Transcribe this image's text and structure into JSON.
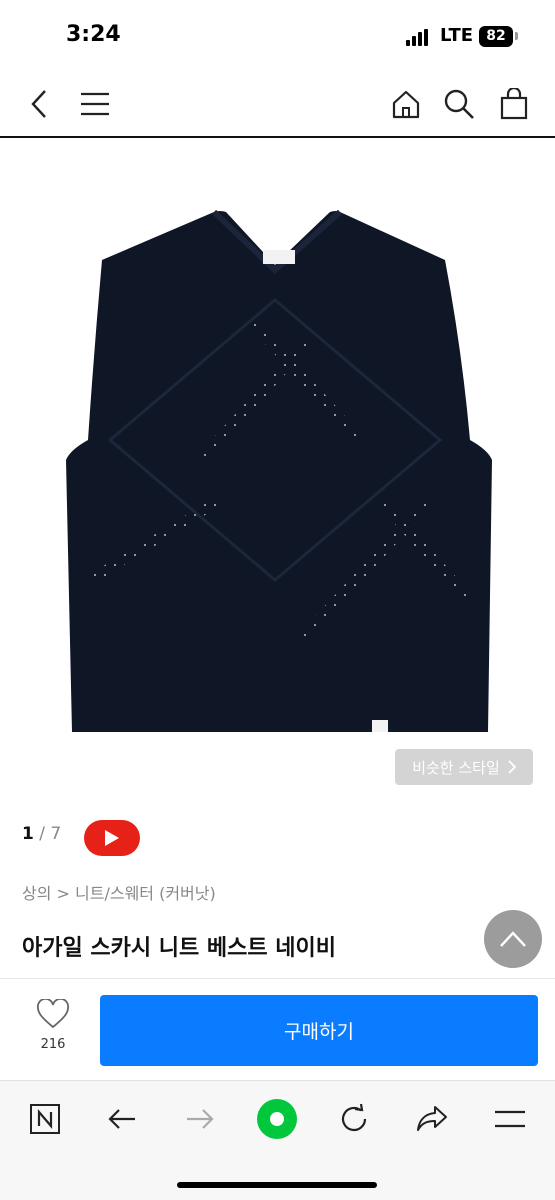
{
  "status_bar": {
    "time": "3:24",
    "network": "LTE",
    "battery": "82"
  },
  "top_nav": {
    "icons": [
      "back-icon",
      "menu-icon",
      "home-icon",
      "search-icon",
      "cart-icon"
    ]
  },
  "product": {
    "image_alt": "navy knit vest",
    "similar_style_label": "비슷한 스타일",
    "pager_current": "1",
    "pager_sep": " / ",
    "pager_total": "7",
    "breadcrumb": "상의 > 니트/스웨터 (커버낫)",
    "title": "아가일 스카시 니트 베스트 네이비"
  },
  "purchase": {
    "like_count": "216",
    "buy_label": "구매하기"
  },
  "browser_bar": {
    "icons": [
      "naver-n-icon",
      "back-arrow-icon",
      "forward-arrow-icon",
      "green-home-icon",
      "refresh-icon",
      "share-icon",
      "menu-icon"
    ]
  },
  "colors": {
    "buy_button": "#0a7cff",
    "youtube": "#e62117",
    "green_button": "#00c73c",
    "vest": "#0f1626"
  }
}
